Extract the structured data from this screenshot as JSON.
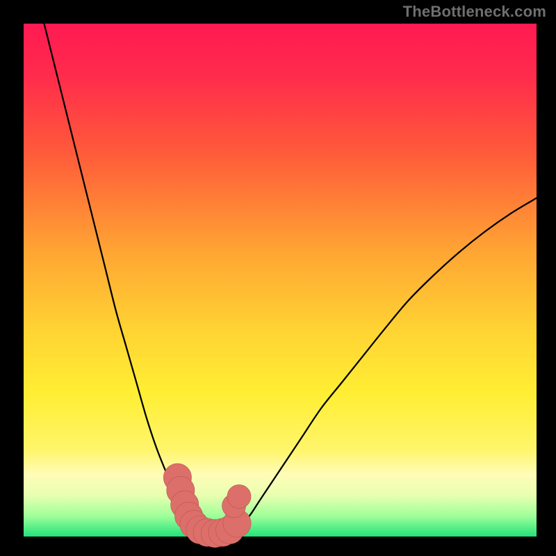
{
  "watermark": "TheBottleneck.com",
  "colors": {
    "frame": "#000000",
    "gradient_stops": [
      {
        "offset": 0.0,
        "color": "#ff1a52"
      },
      {
        "offset": 0.1,
        "color": "#ff2b4c"
      },
      {
        "offset": 0.25,
        "color": "#ff5a3a"
      },
      {
        "offset": 0.45,
        "color": "#ffa733"
      },
      {
        "offset": 0.6,
        "color": "#ffd433"
      },
      {
        "offset": 0.72,
        "color": "#ffee33"
      },
      {
        "offset": 0.83,
        "color": "#fff56a"
      },
      {
        "offset": 0.88,
        "color": "#fffcb8"
      },
      {
        "offset": 0.92,
        "color": "#e8ffb0"
      },
      {
        "offset": 0.96,
        "color": "#9fff9a"
      },
      {
        "offset": 1.0,
        "color": "#22e27a"
      }
    ],
    "curve_stroke": "#000000",
    "marker_fill": "#dd6f6a",
    "marker_stroke": "#b85550"
  },
  "chart_data": {
    "type": "line",
    "title": "",
    "xlabel": "",
    "ylabel": "",
    "xlim": [
      0,
      100
    ],
    "ylim": [
      0,
      100
    ],
    "grid": false,
    "legend": false,
    "series": [
      {
        "name": "left_arm",
        "x": [
          4,
          6,
          8,
          10,
          12,
          14,
          16,
          18,
          20,
          22,
          24,
          26,
          28,
          30,
          32,
          33,
          34
        ],
        "y": [
          100,
          92,
          84,
          76,
          68,
          60,
          52,
          44,
          37,
          30,
          23,
          17,
          12,
          7,
          3.5,
          2,
          1.2
        ]
      },
      {
        "name": "right_arm",
        "x": [
          41,
          42,
          44,
          46,
          48,
          50,
          54,
          58,
          62,
          66,
          70,
          75,
          80,
          85,
          90,
          95,
          100
        ],
        "y": [
          1.2,
          2,
          4,
          7,
          10,
          13,
          19,
          25,
          30,
          35,
          40,
          46,
          51,
          55.5,
          59.5,
          63,
          66
        ]
      },
      {
        "name": "valley_floor",
        "x": [
          33,
          34,
          35,
          36,
          37,
          38,
          39,
          40,
          41
        ],
        "y": [
          2.0,
          1.2,
          0.8,
          0.6,
          0.55,
          0.6,
          0.8,
          1.2,
          2.0
        ]
      }
    ],
    "markers": [
      {
        "x": 30.0,
        "y": 11.5,
        "r": 2.6
      },
      {
        "x": 30.6,
        "y": 9.0,
        "r": 2.6
      },
      {
        "x": 31.4,
        "y": 6.2,
        "r": 2.6
      },
      {
        "x": 32.2,
        "y": 4.0,
        "r": 2.6
      },
      {
        "x": 33.2,
        "y": 2.4,
        "r": 2.6
      },
      {
        "x": 34.4,
        "y": 1.3,
        "r": 2.6
      },
      {
        "x": 35.8,
        "y": 0.8,
        "r": 2.6
      },
      {
        "x": 37.3,
        "y": 0.6,
        "r": 2.6
      },
      {
        "x": 38.8,
        "y": 0.8,
        "r": 2.6
      },
      {
        "x": 40.2,
        "y": 1.3,
        "r": 2.6
      },
      {
        "x": 41.6,
        "y": 2.6,
        "r": 2.6
      },
      {
        "x": 41.0,
        "y": 6.0,
        "r": 2.2
      },
      {
        "x": 42.0,
        "y": 7.8,
        "r": 2.2
      }
    ]
  }
}
